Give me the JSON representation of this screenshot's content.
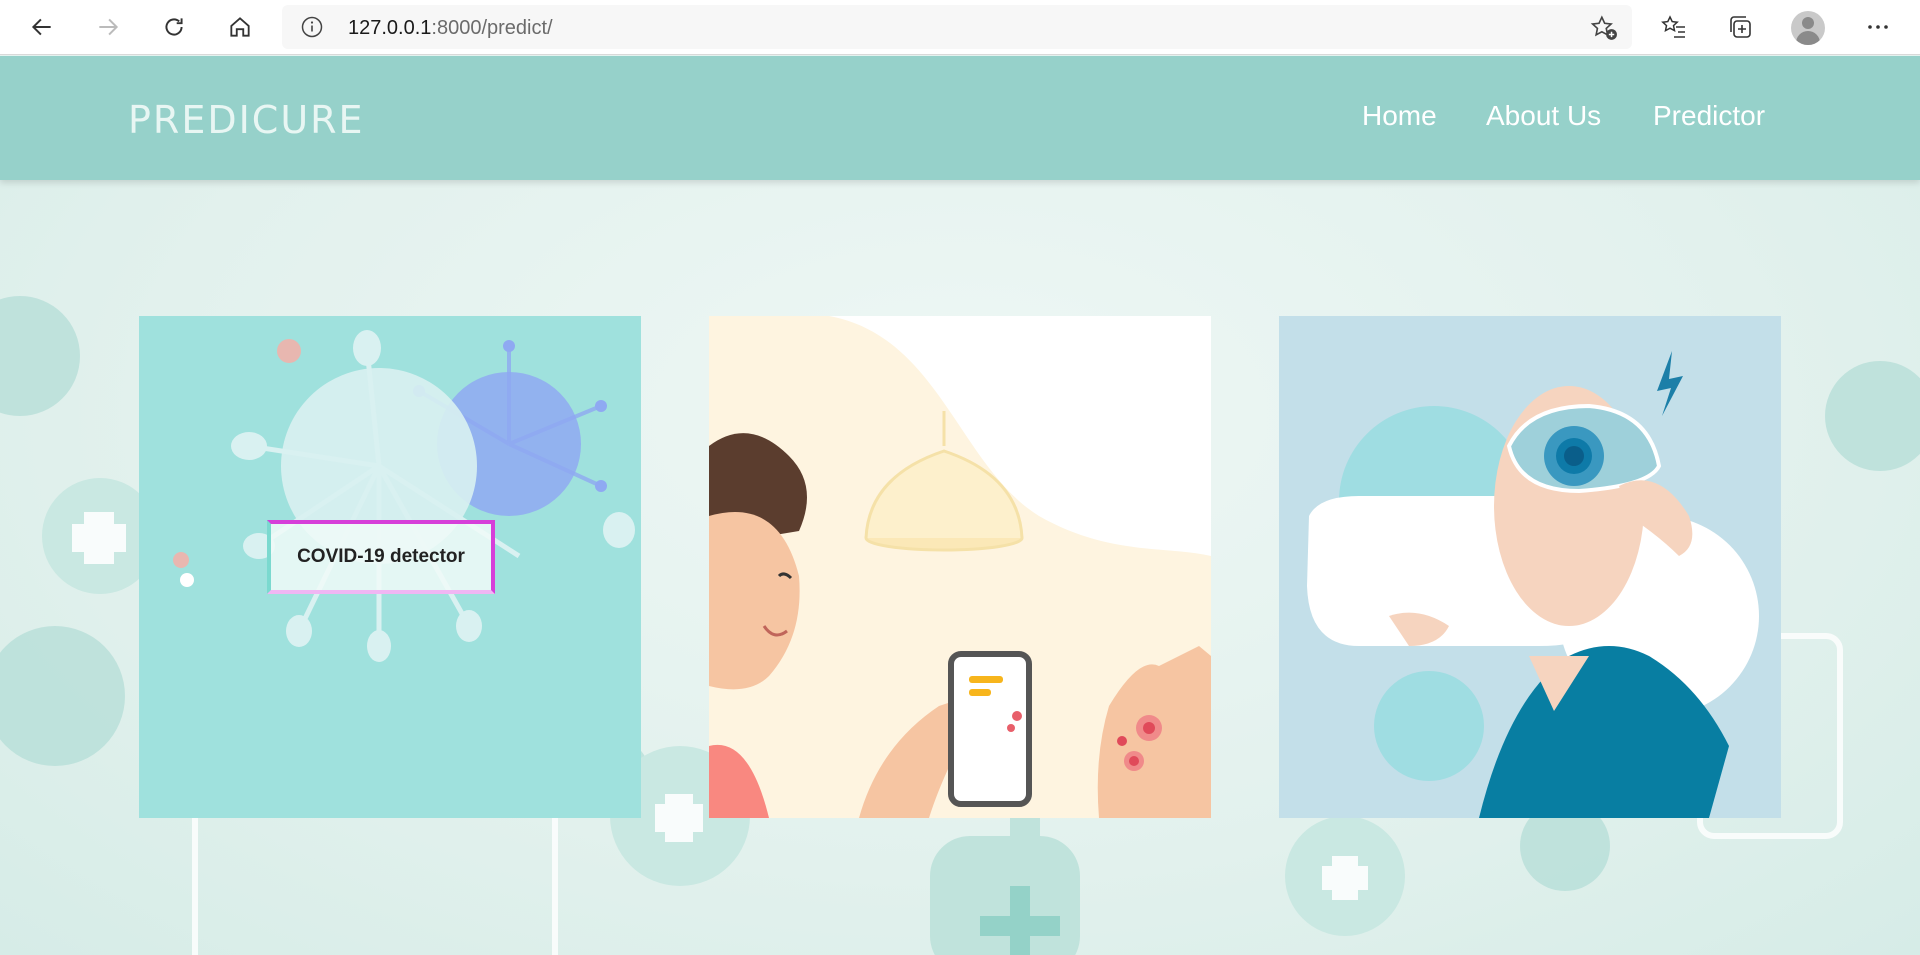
{
  "browser": {
    "url_host": "127.0.0.1",
    "url_rest": ":8000/predict/"
  },
  "navbar": {
    "brand": "PREDICURE",
    "links": [
      {
        "label": "Home"
      },
      {
        "label": "About Us"
      },
      {
        "label": "Predictor"
      }
    ]
  },
  "cards": [
    {
      "button_label": "COVID-19 detector"
    }
  ],
  "colors": {
    "navbar": "#96d1ca",
    "accent_border": "#d63fd9",
    "background": "#e4f2ef"
  }
}
